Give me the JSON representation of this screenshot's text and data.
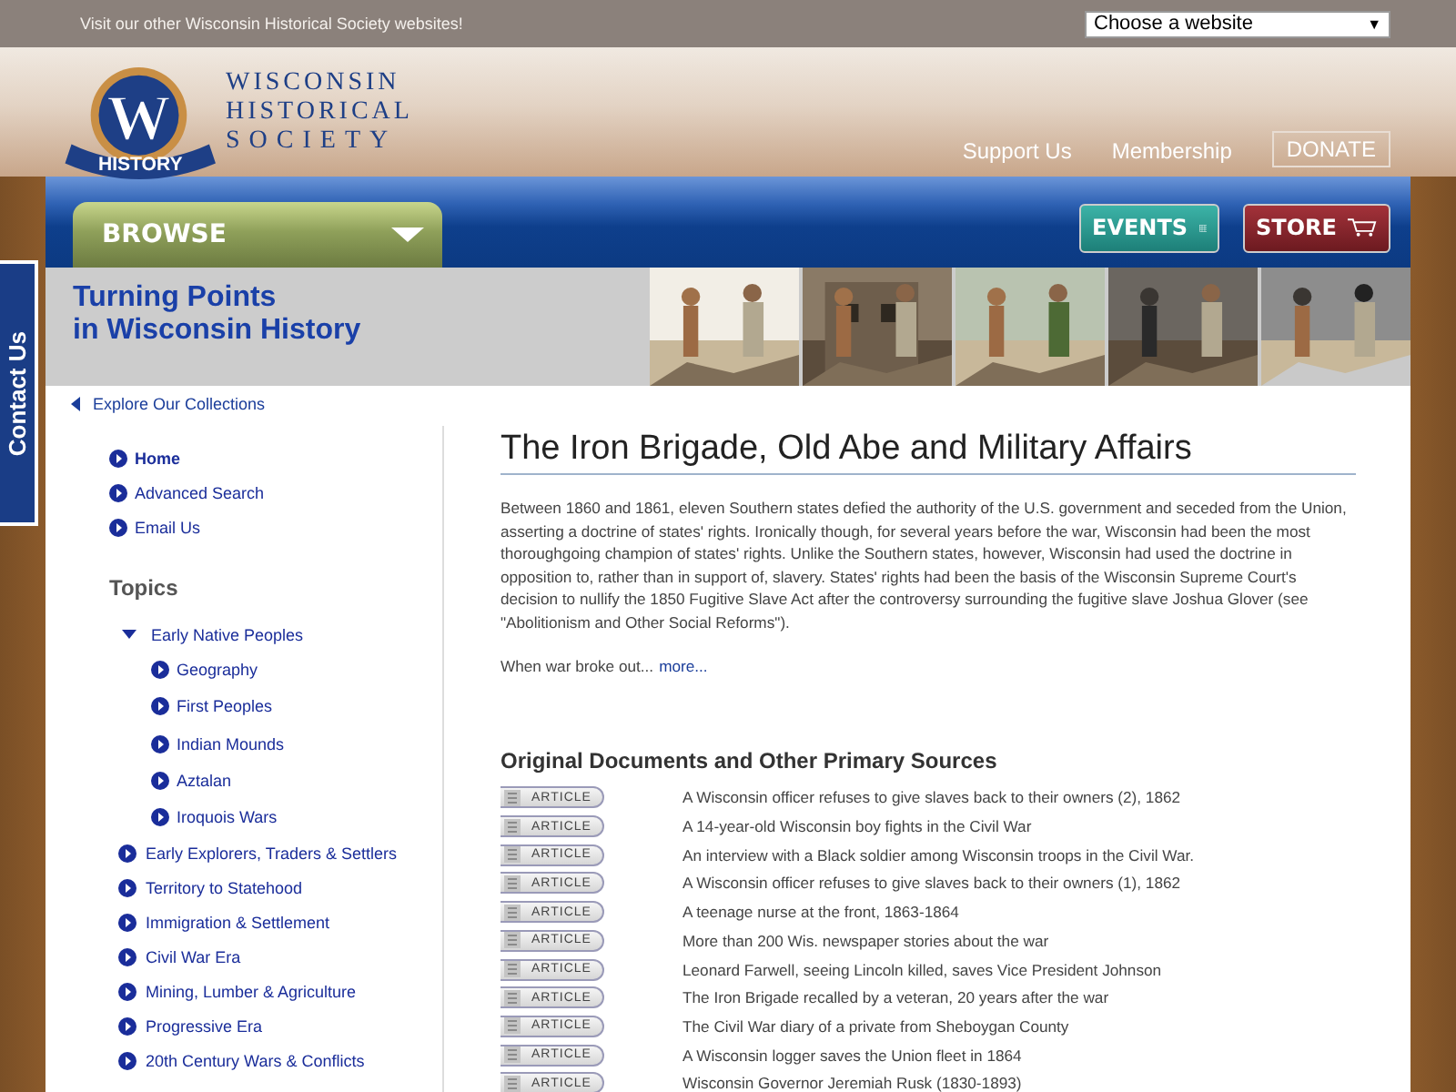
{
  "top_bar": {
    "message": "Visit our other Wisconsin Historical Society websites!",
    "site_select": {
      "value": "Choose a website",
      "arrow": "▼"
    }
  },
  "logo": {
    "badge_letter": "W",
    "badge_ribbon": "HISTORY",
    "lines": [
      "WISCONSIN",
      "HISTORICAL",
      "SOCIETY"
    ]
  },
  "header_links": [
    {
      "label": "Support Us",
      "kind": "link"
    },
    {
      "label": "Membership",
      "kind": "link"
    },
    {
      "label": "DONATE",
      "kind": "boxed"
    }
  ],
  "nav": {
    "browse": "BROWSE",
    "events": "EVENTS",
    "store": "STORE"
  },
  "contact_tab": "Contact Us",
  "banner": {
    "title_lines": [
      "Turning Points",
      "in Wisconsin History"
    ],
    "photos": [
      {
        "kind": "picture"
      },
      {
        "kind": "picture"
      },
      {
        "kind": "picture"
      },
      {
        "kind": "picture"
      },
      {
        "kind": "picture"
      }
    ]
  },
  "back_link": "Explore Our Collections",
  "sidebar": {
    "items": [
      {
        "label": "Home",
        "selected": true
      },
      {
        "label": "Advanced Search",
        "selected": false
      },
      {
        "label": "Email Us",
        "selected": false
      }
    ],
    "topics_heading": "Topics",
    "topics": [
      {
        "label": "Early Native Peoples",
        "expanded": true,
        "children": [
          {
            "label": "Geography"
          },
          {
            "label": "First Peoples"
          },
          {
            "label": "Indian Mounds"
          },
          {
            "label": "Aztalan"
          },
          {
            "label": "Iroquois Wars"
          }
        ]
      },
      {
        "label": "Early Explorers, Traders & Settlers",
        "expanded": false
      },
      {
        "label": "Territory to Statehood",
        "expanded": false
      },
      {
        "label": "Immigration & Settlement",
        "expanded": false
      },
      {
        "label": "Civil War Era",
        "expanded": false
      },
      {
        "label": "Mining, Lumber & Agriculture",
        "expanded": false
      },
      {
        "label": "Progressive Era",
        "expanded": false
      },
      {
        "label": "20th Century Wars & Conflicts",
        "expanded": false
      }
    ]
  },
  "article": {
    "title": "The Iron Brigade, Old Abe and Military Affairs",
    "paragraph": "Between 1860 and 1861, eleven Southern states defied the authority of the U.S. government and seceded from the Union, asserting a doctrine of states' rights. Ironically though, for several years before the war, Wisconsin had been the most thoroughgoing champion of states' rights. Unlike the Southern states, however, Wisconsin had used the doctrine in opposition to, rather than in support of, slavery. States' rights had been the basis of the Wisconsin Supreme Court's decision to nullify the 1850 Fugitive Slave Act after the controversy surrounding the fugitive slave Joshua Glover (see \"Abolitionism and Other Social Reforms\").",
    "teaser": "When war broke out...",
    "more": "more..."
  },
  "sources": {
    "heading": "Original Documents and Other Primary Sources",
    "rows": [
      {
        "type": "ARTICLE",
        "title": "A Wisconsin officer refuses to give slaves back to their owners (2), 1862"
      },
      {
        "type": "ARTICLE",
        "title": "A 14-year-old Wisconsin boy fights in the Civil War"
      },
      {
        "type": "ARTICLE",
        "title": "An interview with a Black soldier among Wisconsin troops in the Civil War."
      },
      {
        "type": "ARTICLE",
        "title": "A Wisconsin officer refuses to give slaves back to their owners (1), 1862"
      },
      {
        "type": "ARTICLE",
        "title": "A teenage nurse at the front, 1863-1864"
      },
      {
        "type": "ARTICLE",
        "title": "More than 200 Wis. newspaper stories about the war"
      },
      {
        "type": "ARTICLE",
        "title": "Leonard Farwell, seeing Lincoln killed, saves Vice President Johnson"
      },
      {
        "type": "ARTICLE",
        "title": "The Iron Brigade recalled by a veteran, 20 years after the war"
      },
      {
        "type": "ARTICLE",
        "title": "The Civil War diary of a private from Sheboygan County"
      },
      {
        "type": "ARTICLE",
        "title": "A Wisconsin logger saves the Union fleet in 1864"
      },
      {
        "type": "ARTICLE",
        "title": "Wisconsin Governor Jeremiah Rusk (1830-1893)"
      }
    ]
  }
}
